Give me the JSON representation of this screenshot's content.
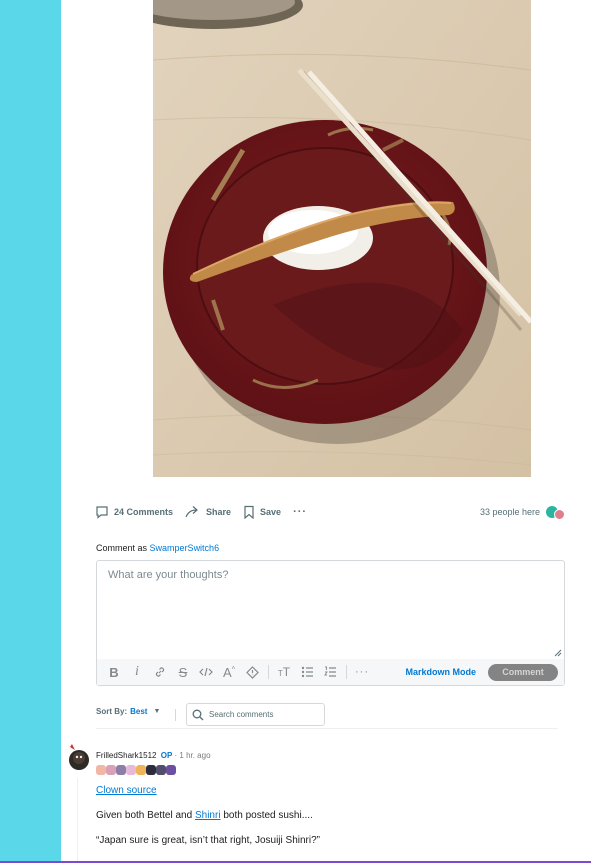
{
  "post": {
    "image_alt": ""
  },
  "actions": {
    "comments_label": "24 Comments",
    "share_label": "Share",
    "save_label": "Save",
    "more_label": "···",
    "online_text": "33 people here"
  },
  "composer": {
    "comment_as_prefix": "Comment as",
    "username": "SwamperSwitch6",
    "placeholder": "What are your thoughts?",
    "toolbar": [
      "bold-icon",
      "italic-icon",
      "link-icon",
      "strikethrough-icon",
      "inline-code-icon",
      "superscript-icon",
      "spoiler-icon",
      "heading-icon",
      "bulleted-list-icon",
      "numbered-list-icon",
      "more-icon"
    ],
    "markdown_mode_label": "Markdown Mode",
    "submit_label": "Comment"
  },
  "sort": {
    "label": "Sort By:",
    "value": "Best",
    "search_placeholder": "Search comments"
  },
  "comments": [
    {
      "author": "FrilledShark1512",
      "op_badge": "OP",
      "separator": " · ",
      "time": "1 hr. ago",
      "link_text": "Clown source",
      "line2_prefix": "Given both Bettel and ",
      "line2_link": "Shinri",
      "line2_suffix": " both posted sushi....",
      "line3": "“Japan sure is great, isn’t that right, Josuiji Shinri?”"
    }
  ],
  "colors": {
    "accent": "#0079d3",
    "side_strip": "#5ad7e8",
    "button_disabled": "#848484"
  }
}
